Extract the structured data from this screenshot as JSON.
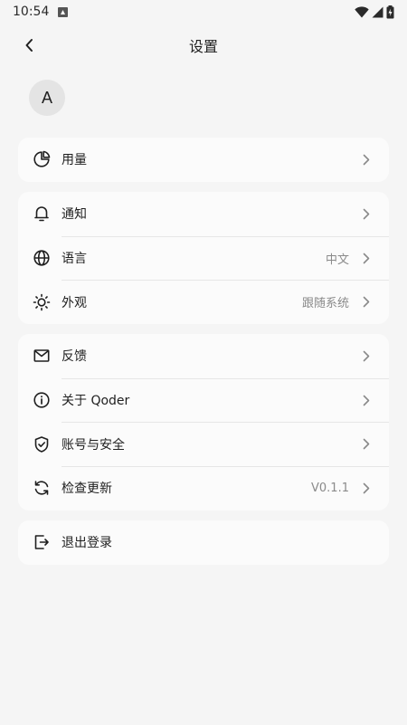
{
  "status_bar": {
    "time": "10:54"
  },
  "header": {
    "title": "设置"
  },
  "profile": {
    "avatar_letter": "A"
  },
  "groups": {
    "usage": {
      "label": "用量"
    },
    "notifications": {
      "label": "通知"
    },
    "language": {
      "label": "语言",
      "value": "中文"
    },
    "appearance": {
      "label": "外观",
      "value": "跟随系统"
    },
    "feedback": {
      "label": "反馈"
    },
    "about": {
      "label": "关于 Qoder"
    },
    "account": {
      "label": "账号与安全"
    },
    "update": {
      "label": "检查更新",
      "value": "V0.1.1"
    },
    "logout": {
      "label": "退出登录"
    }
  }
}
